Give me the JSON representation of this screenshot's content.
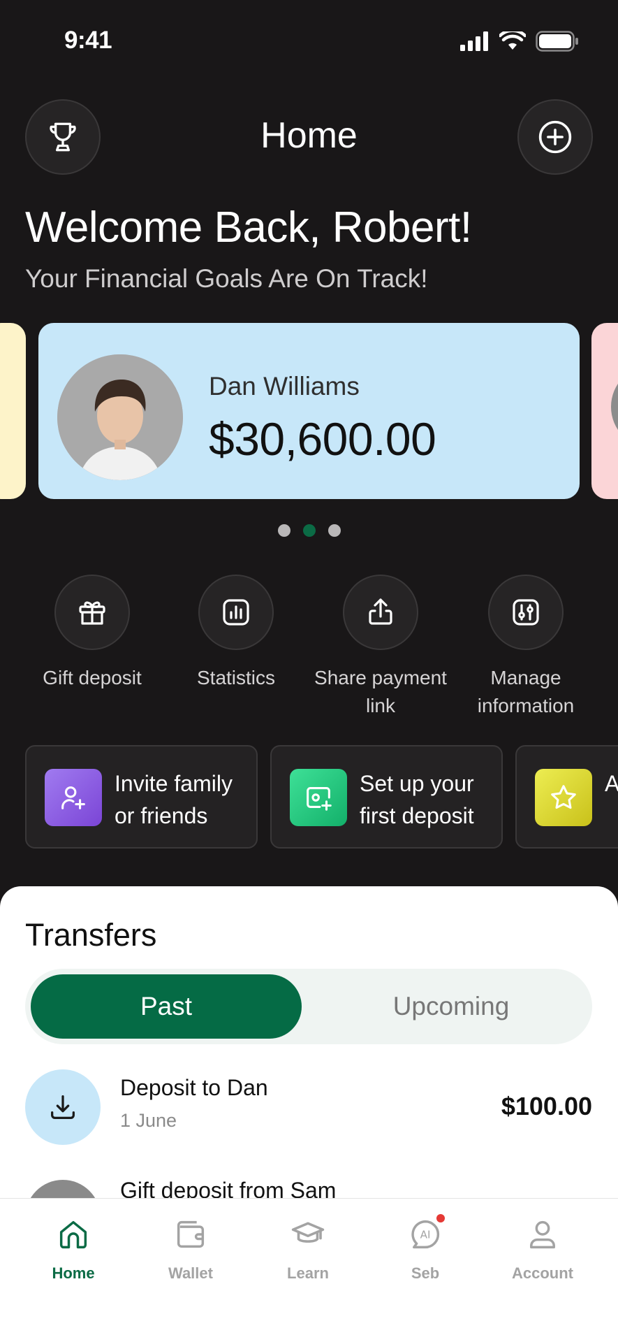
{
  "status_bar": {
    "time": "9:41"
  },
  "header": {
    "title": "Home"
  },
  "welcome": {
    "title": "Welcome Back, Robert!",
    "subtitle": "Your Financial Goals Are On Track!"
  },
  "carousel": {
    "active_card": {
      "name": "Dan Williams",
      "amount": "$30,600.00",
      "color": "#c7e7f9"
    },
    "left_peek_color": "#fdf3c9",
    "right_peek_color": "#fbd5d7",
    "page_count": 3,
    "active_page": 2
  },
  "quick_actions": [
    {
      "label": "Gift deposit",
      "icon": "gift-icon"
    },
    {
      "label": "Statistics",
      "icon": "chart-icon"
    },
    {
      "label": "Share payment link",
      "icon": "share-icon"
    },
    {
      "label": "Manage information",
      "icon": "settings-sliders-icon"
    }
  ],
  "promos": [
    {
      "label": "Invite family or friends",
      "icon": "add-user-icon",
      "color": "#8c5ce0"
    },
    {
      "label": "Set up your first deposit",
      "icon": "money-add-icon",
      "color": "#21c27a"
    },
    {
      "label": "A c",
      "icon": "star-icon",
      "color": "#d9d21f"
    }
  ],
  "transfers": {
    "title": "Transfers",
    "tabs": {
      "past": "Past",
      "upcoming": "Upcoming"
    },
    "items": [
      {
        "title": "Deposit to Dan",
        "date": "1 June",
        "amount": "$100.00"
      },
      {
        "title": "Gift deposit from Sam"
      }
    ]
  },
  "tab_bar": [
    {
      "label": "Home",
      "icon": "home-icon",
      "active": true
    },
    {
      "label": "Wallet",
      "icon": "wallet-icon"
    },
    {
      "label": "Learn",
      "icon": "graduation-cap-icon"
    },
    {
      "label": "Seb",
      "icon": "ai-chat-icon"
    },
    {
      "label": "Account",
      "icon": "user-icon"
    }
  ],
  "colors": {
    "brand_green": "#0b6b45",
    "background": "#191718"
  }
}
